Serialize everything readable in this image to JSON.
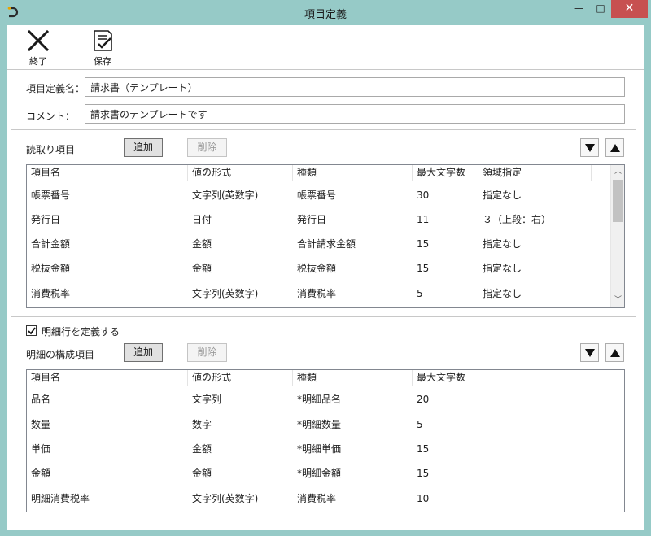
{
  "window": {
    "title": "項目定義",
    "minimize_glyph": "—",
    "maximize_glyph": "□",
    "close_glyph": "✕"
  },
  "toolbar": {
    "exit_label": "終了",
    "save_label": "保存"
  },
  "form": {
    "definition_name_label": "項目定義名：",
    "definition_name_value": "請求書（テンプレート）",
    "comment_label": "コメント：",
    "comment_value": "請求書のテンプレートです"
  },
  "read_items": {
    "label": "読取り項目",
    "add_label": "追加",
    "delete_label": "削除",
    "columns": [
      "項目名",
      "値の形式",
      "種類",
      "最大文字数",
      "領域指定"
    ],
    "rows": [
      [
        "帳票番号",
        "文字列(英数字)",
        "帳票番号",
        "30",
        "指定なし"
      ],
      [
        "発行日",
        "日付",
        "発行日",
        "11",
        "３（上段：右）"
      ],
      [
        "合計金額",
        "金額",
        "合計請求金額",
        "15",
        "指定なし"
      ],
      [
        "税抜金額",
        "金額",
        "税抜金額",
        "15",
        "指定なし"
      ],
      [
        "消費税率",
        "文字列(英数字)",
        "消費税率",
        "5",
        "指定なし"
      ]
    ]
  },
  "detail": {
    "define_checkbox_label": "明細行を定義する",
    "define_checked": true,
    "label": "明細の構成項目",
    "add_label": "追加",
    "delete_label": "削除",
    "columns": [
      "項目名",
      "値の形式",
      "種類",
      "最大文字数"
    ],
    "rows": [
      [
        "品名",
        "文字列",
        "*明細品名",
        "20"
      ],
      [
        "数量",
        "数字",
        "*明細数量",
        "5"
      ],
      [
        "単価",
        "金額",
        "*明細単価",
        "15"
      ],
      [
        "金額",
        "金額",
        "*明細金額",
        "15"
      ],
      [
        "明細消費税率",
        "文字列(英数字)",
        "消費税率",
        "10"
      ]
    ]
  },
  "colors": {
    "window_frame": "#96cac7",
    "close_button": "#c75050"
  },
  "icons": [
    "app-icon",
    "close-x-icon",
    "save-checklist-icon",
    "move-down-icon",
    "move-up-icon",
    "checkmark-icon"
  ]
}
